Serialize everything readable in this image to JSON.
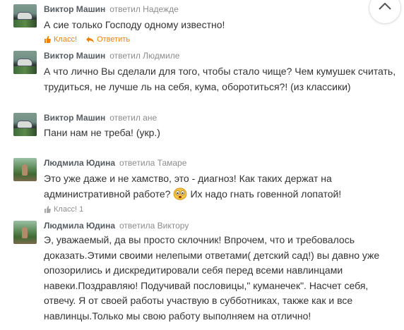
{
  "comments": [
    {
      "author": "Виктор Машин",
      "reply_to": "ответил Надежде",
      "text": "А сие только Господу одному известно!",
      "actions": {
        "like_label": "Класс!",
        "reply_label": "Ответить"
      }
    },
    {
      "author": "Виктор Машин",
      "reply_to": "ответил Людмиле",
      "text": "А что лично Вы сделали для того, чтобы стало чище? Чем кумушек считать, трудиться, не лучше ль на себя, кума, оборотиться?! (из классики)"
    },
    {
      "author": "Виктор Машин",
      "reply_to": "ответил ане",
      "text": "Пани нам не треба! (укр.)"
    },
    {
      "author": "Людмила Юдина",
      "reply_to": "ответила Тамаре",
      "text_before_emoji": "Это уже даже и не хамство, это - диагноз! Как таких держат на административной работе?",
      "text_after_emoji": "Их надо гнать говенной лопатой!",
      "emoji": "shocked-face-emoji",
      "actions": {
        "like_label": "Класс!",
        "like_count": "1"
      }
    },
    {
      "author": "Людмила Юдина",
      "reply_to": "ответила Виктору",
      "text": "Э, уважаемый, да вы  просто склочник! Впрочем, что и требовалось доказать.Этими своими нелепыми ответами( детский сад!) вы давно уже опозорились и дискредитировали себя перед всеми навлинцами навеки.Поздравляю! Подучивай пословицы,\" куманечек\". Насчет себя, отвечу. Я от своей работы участвую в субботниках, также как и все навлинцы.Только мы свою работу выполняем на отлично!"
    }
  ],
  "scroll_up_icon": "chevron-up-icon",
  "colors": {
    "accent": "#ee8208",
    "author": "#555b61",
    "muted": "#8c8c8c",
    "text": "#333333"
  }
}
